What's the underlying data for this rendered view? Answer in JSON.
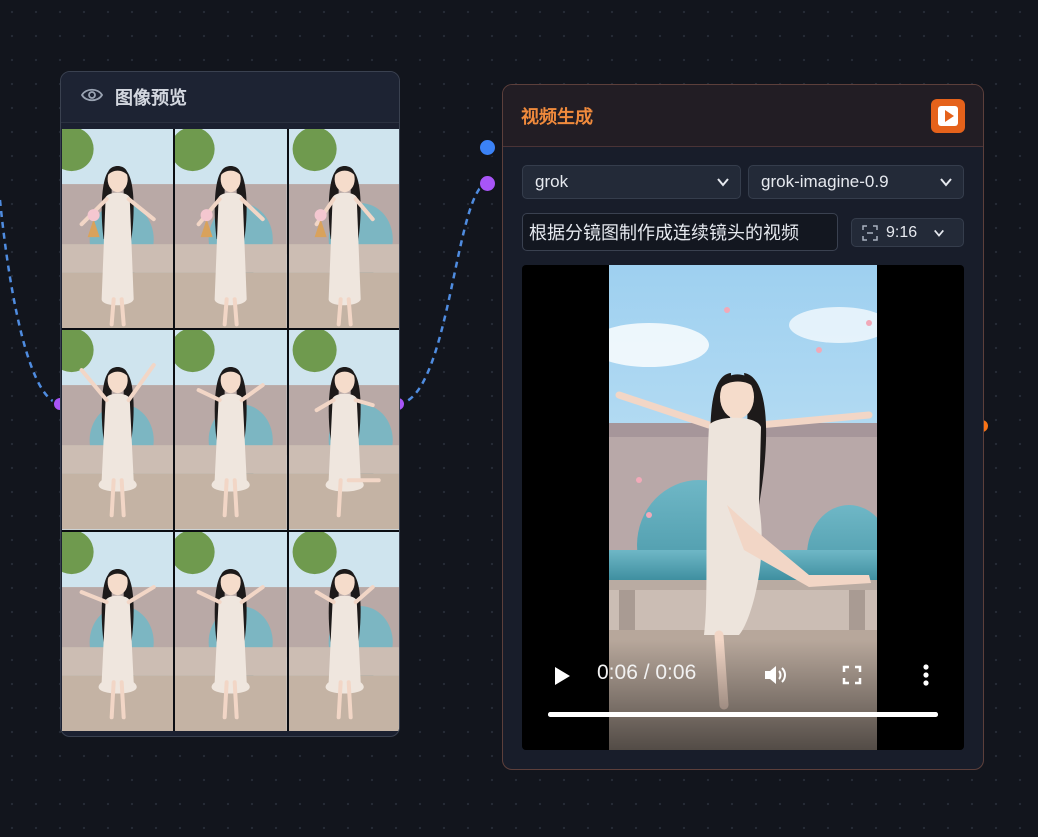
{
  "canvas": {
    "background": "#12151d"
  },
  "preview_node": {
    "title": "图像预览",
    "icon": "eye-icon",
    "frames": [
      {
        "scene": "ice-cream-smile"
      },
      {
        "scene": "ice-cream-laugh"
      },
      {
        "scene": "ice-cream-cheer"
      },
      {
        "scene": "arms-raised"
      },
      {
        "scene": "twirl"
      },
      {
        "scene": "leg-lift"
      },
      {
        "scene": "leap"
      },
      {
        "scene": "spin-skirt"
      },
      {
        "scene": "pose-hand-skirt"
      }
    ]
  },
  "video_node": {
    "title": "视频生成",
    "accent": "#f08a3c",
    "run_icon": "play-icon",
    "provider": {
      "value": "grok"
    },
    "model": {
      "value": "grok-imagine-0.9"
    },
    "prompt": {
      "value": "根据分镜图制作成连续镜头的视频"
    },
    "aspect_ratio": {
      "value": "9:16",
      "icon": "crop-frame-icon"
    },
    "player": {
      "time_display": "0:06 / 0:06",
      "progress": 1.0,
      "icons": [
        "play-icon",
        "volume-icon",
        "fullscreen-icon",
        "more-vertical-icon"
      ]
    }
  },
  "ports": {
    "colors": {
      "image": "#a855f7",
      "blue": "#3b82f6",
      "video": "#f97316"
    }
  }
}
